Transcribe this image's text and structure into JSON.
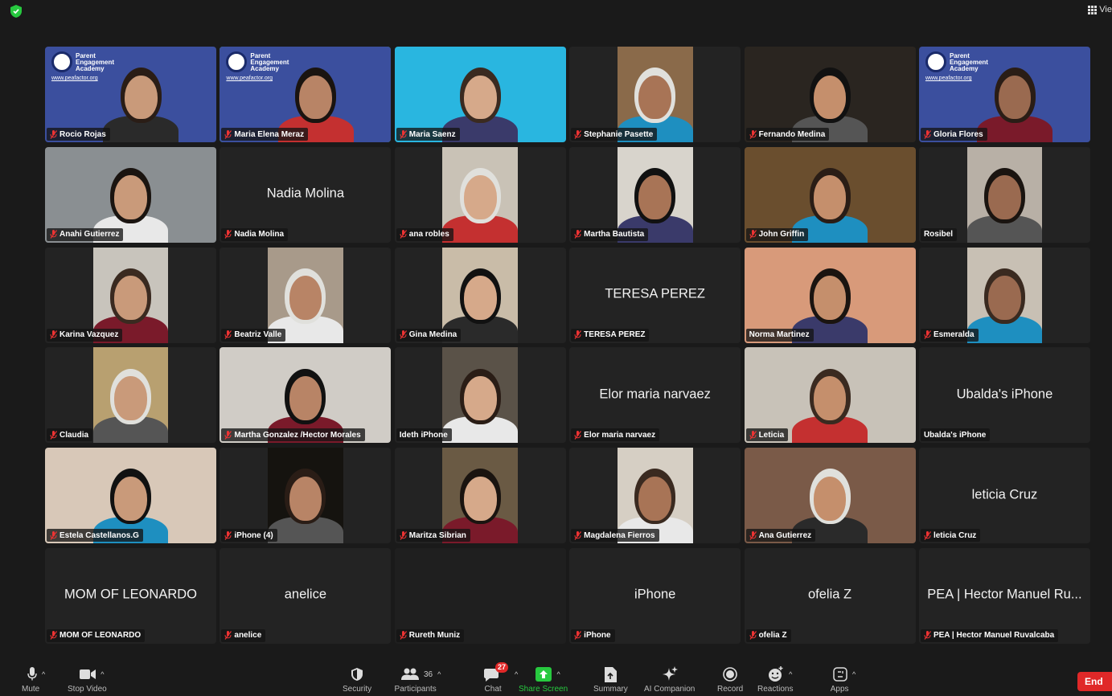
{
  "header": {
    "view_label": "Vie"
  },
  "gallery": {
    "tiles": [
      {
        "label": "Rocio Rojas",
        "muted": true,
        "video": true,
        "bg": "#3b4f9e",
        "logo": true,
        "active": false
      },
      {
        "label": "Maria Elena Meraz",
        "muted": true,
        "video": true,
        "bg": "#3b4f9e",
        "logo": true,
        "active": true
      },
      {
        "label": "Maria Saenz",
        "muted": true,
        "video": true,
        "bg": "#29b6e0",
        "logo": false,
        "active": false
      },
      {
        "label": "Stephanie Pasette",
        "muted": true,
        "video": true,
        "bg": "#8a6a4a",
        "logo": false,
        "active": false
      },
      {
        "label": "Fernando Medina",
        "muted": true,
        "video": true,
        "bg": "#2a2520",
        "logo": false,
        "active": false
      },
      {
        "label": "Gloria Flores",
        "muted": true,
        "video": true,
        "bg": "#3b4f9e",
        "logo": true,
        "active": false
      },
      {
        "label": "Anahi Gutierrez",
        "muted": true,
        "video": true,
        "bg": "#8a8f92",
        "logo": false,
        "active": false
      },
      {
        "label": "Nadia Molina",
        "muted": true,
        "video": false,
        "big": "Nadia Molina",
        "active": false
      },
      {
        "label": "ana robles",
        "muted": true,
        "video": true,
        "bg": "#c9c2b6",
        "logo": false,
        "active": false
      },
      {
        "label": "Martha Bautista",
        "muted": true,
        "video": true,
        "bg": "#d8d4cc",
        "logo": false,
        "active": false
      },
      {
        "label": "John Griffin",
        "muted": true,
        "video": true,
        "bg": "#6a4e2e",
        "logo": false,
        "active": false
      },
      {
        "label": "Rosibel",
        "muted": false,
        "video": true,
        "bg": "#b8b0a6",
        "logo": false,
        "active": false
      },
      {
        "label": "Karina Vazquez",
        "muted": true,
        "video": true,
        "bg": "#c8c4bc",
        "logo": false,
        "active": false
      },
      {
        "label": "Beatriz Valle",
        "muted": true,
        "video": true,
        "bg": "#a89a8a",
        "logo": false,
        "active": false
      },
      {
        "label": "Gina Medina",
        "muted": true,
        "video": true,
        "bg": "#c9bca8",
        "logo": false,
        "active": false
      },
      {
        "label": "TERESA PEREZ",
        "muted": true,
        "video": false,
        "big": "TERESA PEREZ",
        "active": false
      },
      {
        "label": "Norma Martinez",
        "muted": false,
        "video": true,
        "bg": "#d89a7a",
        "logo": false,
        "active": false
      },
      {
        "label": "Esmeralda",
        "muted": true,
        "video": true,
        "bg": "#c8c0b4",
        "logo": false,
        "active": false
      },
      {
        "label": "Claudia",
        "muted": true,
        "video": true,
        "bg": "#b8a070",
        "logo": false,
        "active": false
      },
      {
        "label": "Martha Gonzalez /Hector Morales",
        "muted": true,
        "video": true,
        "bg": "#d0ccc6",
        "logo": false,
        "active": false
      },
      {
        "label": "Ideth iPhone",
        "muted": false,
        "video": true,
        "bg": "#5a5248",
        "logo": false,
        "active": false
      },
      {
        "label": "Elor maria narvaez",
        "muted": true,
        "video": false,
        "big": "Elor maria narvaez",
        "active": false
      },
      {
        "label": "Leticia",
        "muted": true,
        "video": true,
        "bg": "#c8c2b8",
        "logo": false,
        "active": false
      },
      {
        "label": "Ubalda's iPhone",
        "muted": false,
        "video": false,
        "big": "Ubalda's iPhone",
        "active": false
      },
      {
        "label": "Estela Castellanos.G",
        "muted": true,
        "video": true,
        "bg": "#d8c8b8",
        "logo": false,
        "active": false
      },
      {
        "label": "iPhone (4)",
        "muted": true,
        "video": true,
        "bg": "#15130f",
        "logo": false,
        "active": false
      },
      {
        "label": "Maritza Sibrian",
        "muted": true,
        "video": true,
        "bg": "#6a5a44",
        "logo": false,
        "active": false
      },
      {
        "label": "Magdalena Fierros",
        "muted": true,
        "video": true,
        "bg": "#d6cfc4",
        "logo": false,
        "active": false
      },
      {
        "label": "Ana Gutierrez",
        "muted": true,
        "video": true,
        "bg": "#7a5a48",
        "logo": false,
        "active": false
      },
      {
        "label": "leticia Cruz",
        "muted": true,
        "video": false,
        "big": "leticia Cruz",
        "active": false
      },
      {
        "label": "MOM OF LEONARDO",
        "muted": true,
        "video": false,
        "big": "MOM OF LEONARDO",
        "active": false
      },
      {
        "label": "anelice",
        "muted": true,
        "video": false,
        "big": "anelice",
        "active": false
      },
      {
        "label": "Rureth Muniz",
        "muted": true,
        "video": true,
        "bg": "#1f1f1f",
        "logo": false,
        "active": false
      },
      {
        "label": "iPhone",
        "muted": true,
        "video": false,
        "big": "iPhone",
        "active": false
      },
      {
        "label": "ofelia Z",
        "muted": true,
        "video": false,
        "big": "ofelia Z",
        "active": false
      },
      {
        "label": "PEA | Hector Manuel Ruvalcaba",
        "muted": true,
        "video": false,
        "big": "PEA | Hector Manuel Ru...",
        "active": false
      }
    ],
    "logo_text": [
      "Parent",
      "Engagement",
      "Academy"
    ],
    "logo_url": "www.peafactor.org"
  },
  "toolbar": {
    "mute": "Mute",
    "stop_video": "Stop Video",
    "security": "Security",
    "participants": "Participants",
    "participants_count": "36",
    "chat": "Chat",
    "chat_badge": "27",
    "share_screen": "Share Screen",
    "summary": "Summary",
    "ai_companion": "AI Companion",
    "record": "Record",
    "reactions": "Reactions",
    "apps": "Apps",
    "end": "End"
  },
  "colors": {
    "accent_green": "#27c93f",
    "end_red": "#e02828",
    "active_border": "#4cd964"
  }
}
